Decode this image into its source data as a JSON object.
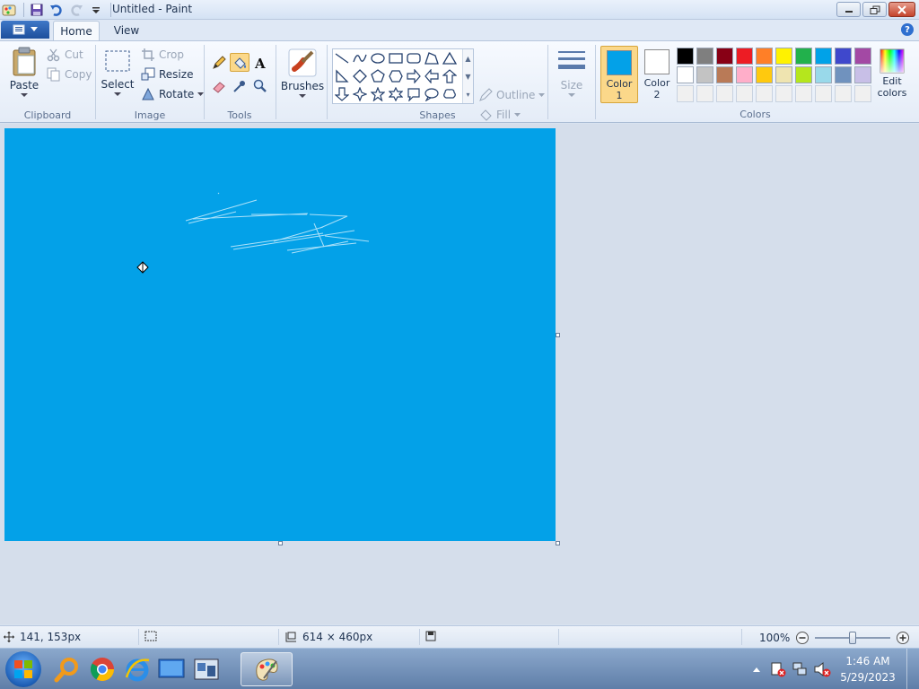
{
  "window": {
    "title": "Untitled - Paint"
  },
  "tabs": [
    {
      "label": "Home"
    },
    {
      "label": "View"
    }
  ],
  "ribbon": {
    "clipboard": {
      "label": "Clipboard",
      "paste": "Paste",
      "cut": "Cut",
      "copy": "Copy"
    },
    "image": {
      "label": "Image",
      "select": "Select",
      "crop": "Crop",
      "resize": "Resize",
      "rotate": "Rotate"
    },
    "tools": {
      "label": "Tools",
      "active_tool": "fill-tool"
    },
    "brushes": {
      "label": "Brushes"
    },
    "shapes": {
      "label": "Shapes",
      "outline": "Outline",
      "fill": "Fill"
    },
    "size": {
      "label": "Size"
    },
    "colors": {
      "label": "Colors",
      "color1_label_line1": "Color",
      "color1_label_line2": "1",
      "color2_label_line1": "Color",
      "color2_label_line2": "2",
      "color1": "#03a1e8",
      "color2": "#ffffff",
      "edit_line1": "Edit",
      "edit_line2": "colors",
      "palette_row1": [
        "#000000",
        "#7f7f7f",
        "#880015",
        "#ed1c24",
        "#ff7f27",
        "#fff200",
        "#22b14c",
        "#00a2e8",
        "#3f48cc",
        "#a349a4"
      ],
      "palette_row2": [
        "#ffffff",
        "#c3c3c3",
        "#b97a57",
        "#ffaec9",
        "#ffc90e",
        "#efe4b0",
        "#b5e61d",
        "#99d9ea",
        "#7092be",
        "#c8bfe7"
      ],
      "palette_row3": [
        "#f0f0f0",
        "#f0f0f0",
        "#f0f0f0",
        "#f0f0f0",
        "#f0f0f0",
        "#f0f0f0",
        "#f0f0f0",
        "#f0f0f0",
        "#f0f0f0",
        "#f0f0f0"
      ]
    }
  },
  "canvas": {
    "fill_color": "#03a1e8"
  },
  "status": {
    "cursor_position": "141, 153px",
    "canvas_size": "614 × 460px",
    "zoom": "100%"
  },
  "taskbar": {
    "time": "1:46 AM",
    "date": "5/29/2023"
  }
}
